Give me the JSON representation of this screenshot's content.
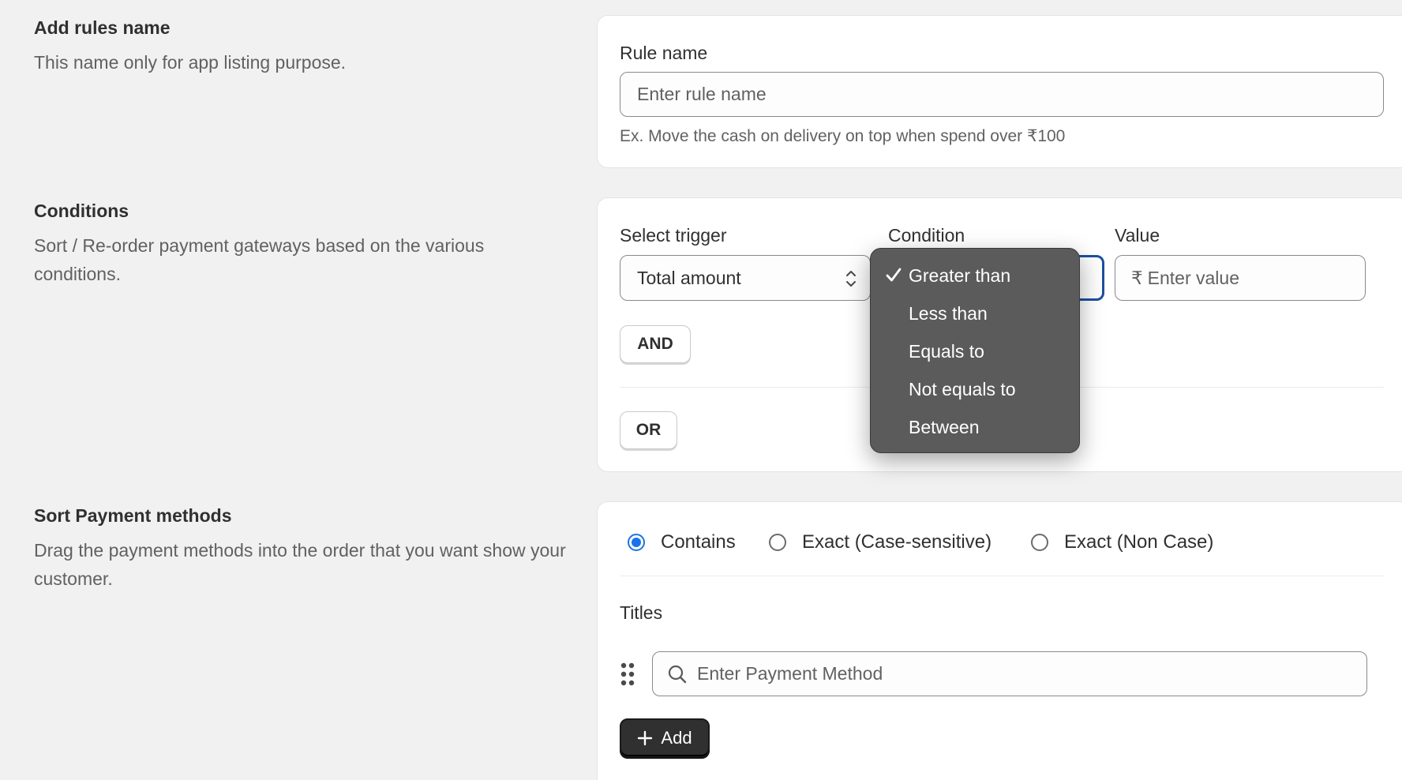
{
  "sections": {
    "rule_name": {
      "title": "Add rules name",
      "description": "This name only for app listing purpose.",
      "field_label": "Rule name",
      "field_placeholder": "Enter rule name",
      "help": "Ex. Move the cash on delivery on top when spend over ₹100"
    },
    "conditions": {
      "title": "Conditions",
      "description": "Sort / Re-order payment gateways based on the various conditions.",
      "trigger_label": "Select trigger",
      "trigger_value": "Total amount",
      "condition_label": "Condition",
      "value_label": "Value",
      "currency_symbol": "₹",
      "value_placeholder": "Enter value",
      "and_button": "AND",
      "or_button": "OR",
      "dropdown": {
        "selected": "Greater than",
        "options": [
          "Greater than",
          "Less than",
          "Equals to",
          "Not equals to",
          "Between"
        ]
      }
    },
    "sort": {
      "title": "Sort Payment methods",
      "description": "Drag the payment methods into the order that you want show your customer.",
      "match_options": [
        "Contains",
        "Exact (Case-sensitive)",
        "Exact (Non Case)"
      ],
      "match_selected": "Contains",
      "titles_label": "Titles",
      "search_placeholder": "Enter Payment Method",
      "add_button": "Add"
    }
  },
  "icons": {
    "check": "check-icon",
    "stepper": "select-chevrons-icon",
    "search": "search-icon",
    "drag": "drag-handle-icon",
    "plus": "plus-icon"
  },
  "colors": {
    "page_bg": "#f1f1f1",
    "card_bg": "#ffffff",
    "accent_blue": "#1a73e8",
    "dropdown_bg": "#5b5b5b",
    "primary_button": "#303030"
  }
}
